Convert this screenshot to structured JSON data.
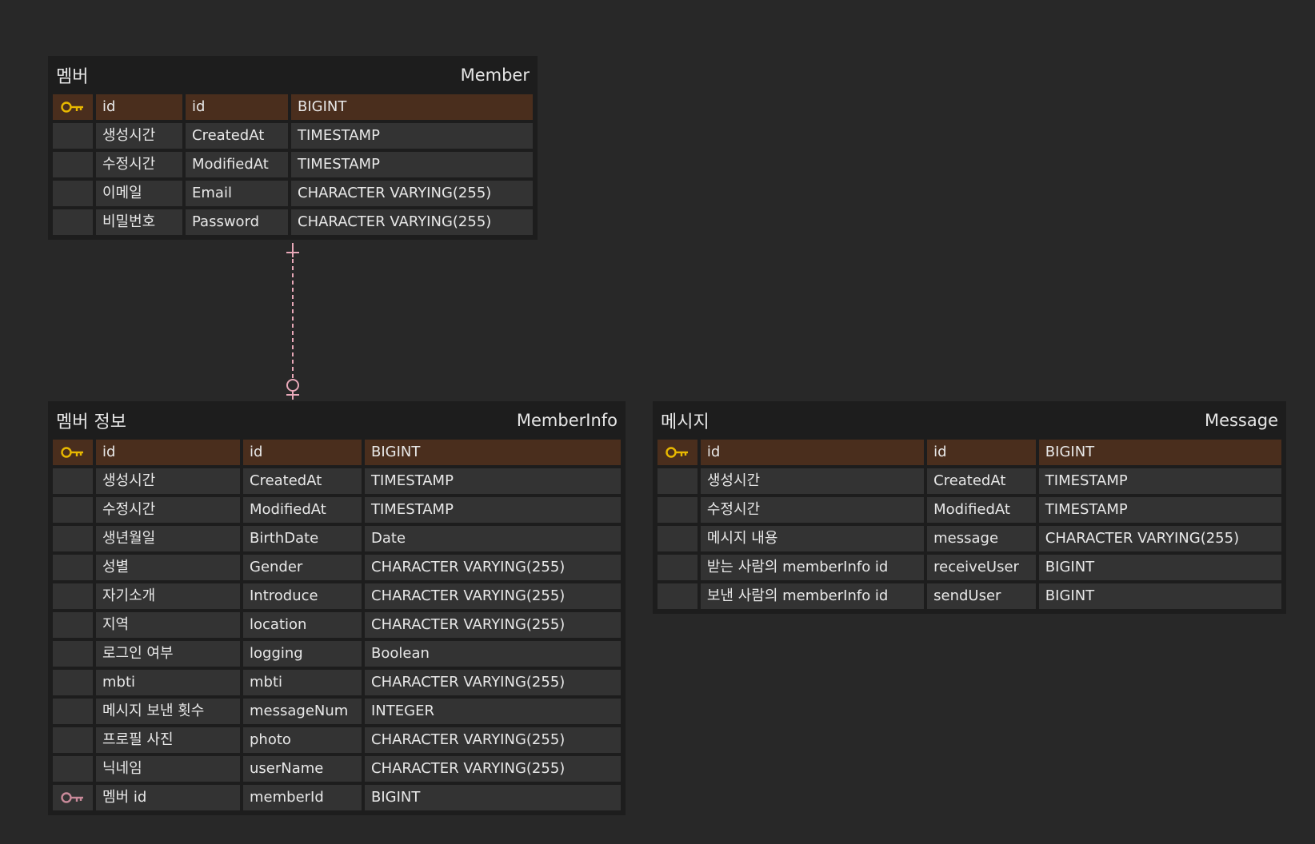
{
  "colors": {
    "background": "#282828",
    "entity_bg": "#1d1d1d",
    "cell_bg": "#333333",
    "pk_row_bg": "#4a2e1d",
    "pk_icon": "#e8b800",
    "fk_icon": "#c98a9a",
    "relation_line": "#e8a8b8"
  },
  "entities": {
    "member": {
      "kor_name": "멤버",
      "eng_name": "Member",
      "rows": [
        {
          "key": "pk-icon",
          "logical": "id",
          "physical": "id",
          "type": "BIGINT"
        },
        {
          "key": "",
          "logical": "생성시간",
          "physical": "CreatedAt",
          "type": "TIMESTAMP"
        },
        {
          "key": "",
          "logical": "수정시간",
          "physical": "ModifiedAt",
          "type": "TIMESTAMP"
        },
        {
          "key": "",
          "logical": "이메일",
          "physical": "Email",
          "type": "CHARACTER VARYING(255)"
        },
        {
          "key": "",
          "logical": "비밀번호",
          "physical": "Password",
          "type": "CHARACTER VARYING(255)"
        }
      ]
    },
    "member_info": {
      "kor_name": "멤버 정보",
      "eng_name": "MemberInfo",
      "rows": [
        {
          "key": "pk-icon",
          "logical": "id",
          "physical": "id",
          "type": "BIGINT"
        },
        {
          "key": "",
          "logical": "생성시간",
          "physical": "CreatedAt",
          "type": "TIMESTAMP"
        },
        {
          "key": "",
          "logical": "수정시간",
          "physical": "ModifiedAt",
          "type": "TIMESTAMP"
        },
        {
          "key": "",
          "logical": "생년월일",
          "physical": "BirthDate",
          "type": "Date"
        },
        {
          "key": "",
          "logical": "성별",
          "physical": "Gender",
          "type": "CHARACTER VARYING(255)"
        },
        {
          "key": "",
          "logical": "자기소개",
          "physical": "Introduce",
          "type": "CHARACTER VARYING(255)"
        },
        {
          "key": "",
          "logical": "지역",
          "physical": "location",
          "type": "CHARACTER VARYING(255)"
        },
        {
          "key": "",
          "logical": "로그인 여부",
          "physical": "logging",
          "type": "Boolean"
        },
        {
          "key": "",
          "logical": "mbti",
          "physical": "mbti",
          "type": "CHARACTER VARYING(255)"
        },
        {
          "key": "",
          "logical": "메시지 보낸 횟수",
          "physical": "messageNum",
          "type": "INTEGER"
        },
        {
          "key": "",
          "logical": "프로필 사진",
          "physical": "photo",
          "type": "CHARACTER VARYING(255)"
        },
        {
          "key": "",
          "logical": "닉네임",
          "physical": "userName",
          "type": "CHARACTER VARYING(255)"
        },
        {
          "key": "fk-icon",
          "logical": "멤버 id",
          "physical": "memberId",
          "type": "BIGINT"
        }
      ]
    },
    "message": {
      "kor_name": "메시지",
      "eng_name": "Message",
      "rows": [
        {
          "key": "pk-icon",
          "logical": "id",
          "physical": "id",
          "type": "BIGINT"
        },
        {
          "key": "",
          "logical": "생성시간",
          "physical": "CreatedAt",
          "type": "TIMESTAMP"
        },
        {
          "key": "",
          "logical": "수정시간",
          "physical": "ModifiedAt",
          "type": "TIMESTAMP"
        },
        {
          "key": "",
          "logical": "메시지 내용",
          "physical": "message",
          "type": "CHARACTER VARYING(255)"
        },
        {
          "key": "",
          "logical": "받는 사람의 memberInfo id",
          "physical": "receiveUser",
          "type": "BIGINT"
        },
        {
          "key": "",
          "logical": "보낸 사람의 memberInfo id",
          "physical": "sendUser",
          "type": "BIGINT"
        }
      ]
    }
  },
  "relationships": [
    {
      "from": "member",
      "to": "member_info",
      "from_end": "one",
      "to_end": "zero-or-one",
      "style": "dashed"
    }
  ]
}
